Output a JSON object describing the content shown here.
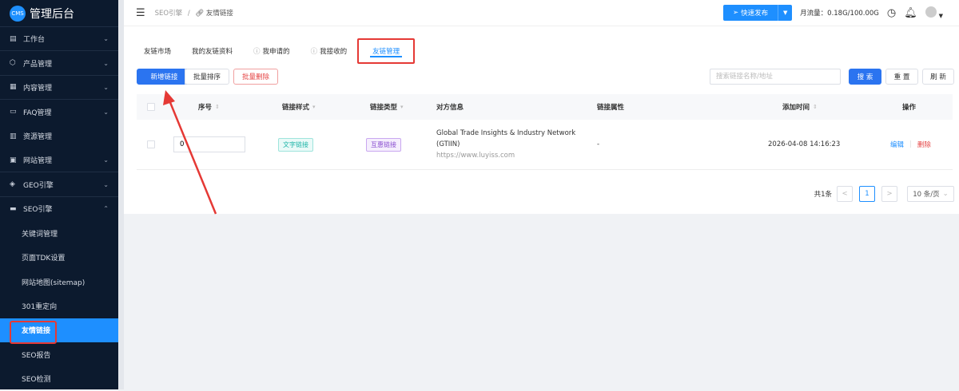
{
  "app": {
    "logo_badge": "CMS",
    "title": "管理后台"
  },
  "sidebar": {
    "items": [
      {
        "label": "工作台",
        "icon": "monitor-icon",
        "chevron": "⌄"
      },
      {
        "label": "产品管理",
        "icon": "box-icon",
        "chevron": "⌄"
      },
      {
        "label": "内容管理",
        "icon": "document-icon",
        "chevron": "⌄"
      },
      {
        "label": "FAQ管理",
        "icon": "ticket-icon",
        "chevron": "⌄"
      },
      {
        "label": "资源管理",
        "icon": "folder-icon",
        "chevron": ""
      },
      {
        "label": "网站管理",
        "icon": "window-icon",
        "chevron": "⌄"
      },
      {
        "label": "GEO引擎",
        "icon": "diamond-icon",
        "chevron": "⌄"
      },
      {
        "label": "SEO引擎",
        "icon": "seo-icon",
        "chevron": "⌃"
      }
    ],
    "sub_items": [
      "关键词管理",
      "页面TDK设置",
      "网站地图(sitemap)",
      "301重定向",
      "友情链接",
      "SEO报告",
      "SEO检测"
    ]
  },
  "header": {
    "breadcrumb_parent": "SEO引擎",
    "breadcrumb_sep": "/",
    "breadcrumb_current": "友情链接",
    "publish_label": "快速发布",
    "flow_label": "月流量：0.18G/100.00G"
  },
  "tabs": [
    "友链市场",
    "我的友链资料",
    "我申请的",
    "我接收的",
    "友链管理"
  ],
  "toolbar": {
    "add": "新增链接",
    "sort": "批量排序",
    "delete": "批量删除",
    "search_placeholder": "搜索链接名称/地址",
    "search": "搜 索",
    "reset": "重 置",
    "refresh": "刷 新"
  },
  "table": {
    "columns": [
      "序号",
      "链接样式",
      "链接类型",
      "对方信息",
      "链接属性",
      "添加时间",
      "操作"
    ],
    "rows": [
      {
        "order": "0",
        "style": "文字链接",
        "type": "互惠链接",
        "name": "Global Trade Insights & Industry Network (GTIIN)",
        "url": "https://www.luyiss.com",
        "attr": "-",
        "time": "2026-04-08 14:16:23",
        "edit": "编辑",
        "sep": "|",
        "del": "删除"
      }
    ]
  },
  "pagination": {
    "total": "共1条",
    "prev": "<",
    "page": "1",
    "next": ">",
    "size": "10 条/页"
  },
  "colors": {
    "sidebar": "#0c1a2e",
    "accent": "#1e8fff",
    "danger": "#e54545",
    "highlight": "#e53935"
  }
}
